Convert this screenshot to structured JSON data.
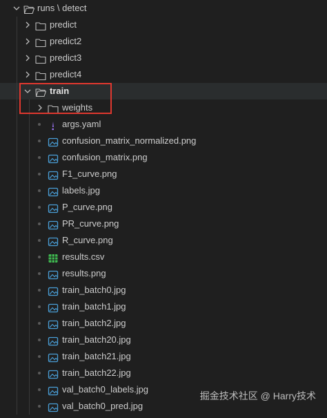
{
  "explorer": {
    "root": {
      "label": "runs \\ detect",
      "expanded": true
    },
    "folders": [
      {
        "label": "predict",
        "expanded": false
      },
      {
        "label": "predict2",
        "expanded": false
      },
      {
        "label": "predict3",
        "expanded": false
      },
      {
        "label": "predict4",
        "expanded": false
      }
    ],
    "train": {
      "label": "train",
      "expanded": true,
      "subfolder": {
        "label": "weights",
        "expanded": false
      },
      "files": [
        {
          "label": "args.yaml",
          "icon": "exclamation-icon"
        },
        {
          "label": "confusion_matrix_normalized.png",
          "icon": "image-icon"
        },
        {
          "label": "confusion_matrix.png",
          "icon": "image-icon"
        },
        {
          "label": "F1_curve.png",
          "icon": "image-icon"
        },
        {
          "label": "labels.jpg",
          "icon": "image-icon"
        },
        {
          "label": "P_curve.png",
          "icon": "image-icon"
        },
        {
          "label": "PR_curve.png",
          "icon": "image-icon"
        },
        {
          "label": "R_curve.png",
          "icon": "image-icon"
        },
        {
          "label": "results.csv",
          "icon": "table-icon"
        },
        {
          "label": "results.png",
          "icon": "image-icon"
        },
        {
          "label": "train_batch0.jpg",
          "icon": "image-icon"
        },
        {
          "label": "train_batch1.jpg",
          "icon": "image-icon"
        },
        {
          "label": "train_batch2.jpg",
          "icon": "image-icon"
        },
        {
          "label": "train_batch20.jpg",
          "icon": "image-icon"
        },
        {
          "label": "train_batch21.jpg",
          "icon": "image-icon"
        },
        {
          "label": "train_batch22.jpg",
          "icon": "image-icon"
        },
        {
          "label": "val_batch0_labels.jpg",
          "icon": "image-icon"
        },
        {
          "label": "val_batch0_pred.jpg",
          "icon": "image-icon"
        }
      ]
    }
  },
  "watermark": "掘金技术社区 @ Harry技术",
  "colors": {
    "background": "#1f1f1f",
    "text": "#cccccc",
    "highlight_border": "#e0382f",
    "image_icon": "#4a9fd8",
    "yaml_icon": "#a277ff",
    "csv_icon": "#3fb950"
  }
}
